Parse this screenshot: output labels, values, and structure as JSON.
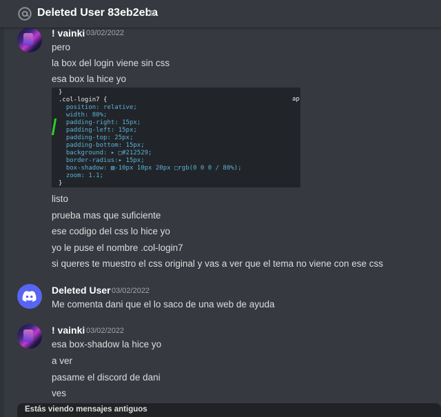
{
  "header": {
    "title": "Deleted User 83eb2eba",
    "icon": "at-icon",
    "status": "offline"
  },
  "messages": [
    {
      "author": "! vainki",
      "timestamp": "03/02/2022",
      "lines_before": [
        "pero",
        "la box del login viene sin css",
        "esa box la hice yo"
      ],
      "code_lines": [
        "}",
        ".col-login7 {",
        "  position: relative;",
        "  width: 80%;",
        "  padding-right: 15px;",
        "  padding-left: 15px;",
        "  padding-top: 25px;",
        "  padding-bottom: 15px;",
        "  background: ▸ □#212529;",
        "  border-radius:▸ 15px;",
        "  box-shadow: ▧-10px 10px 20px □rgb(0 0 0 / 80%);",
        "  zoom: 1.1;",
        "}"
      ],
      "code_side": "ap",
      "lines_after": [
        "listo",
        "prueba mas que suficiente",
        "ese codigo del css lo hice yo",
        "yo le puse el nombre .col-login7",
        "si queres te muestro el css original y vas a ver que el tema no viene con ese css"
      ]
    },
    {
      "author": "Deleted User",
      "timestamp": "03/02/2022",
      "lines": [
        "Me comenta dani que el lo saco de una web de ayuda"
      ]
    },
    {
      "author": "! vainki",
      "timestamp": "03/02/2022",
      "lines": [
        "esa box-shadow la hice yo",
        "a ver",
        "pasame el discord de dani",
        "ves"
      ]
    }
  ],
  "banner": {
    "text": "Estás viendo mensajes antiguos"
  },
  "colors": {
    "background": "#36393f",
    "blurple": "#5865f2",
    "code_bg": "#212529",
    "accent_green": "#31d02b"
  }
}
